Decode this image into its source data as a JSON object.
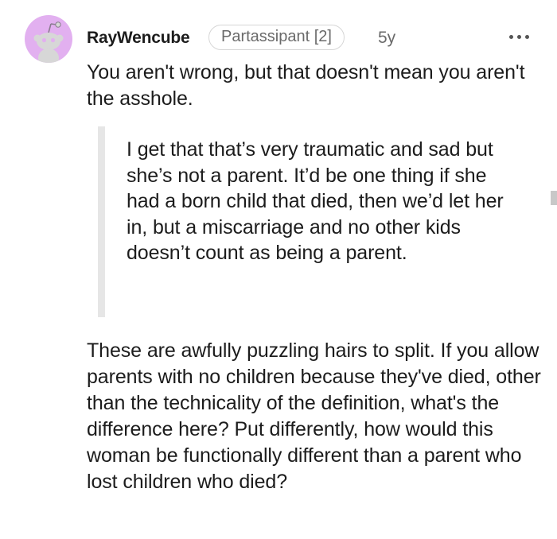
{
  "comment": {
    "author": "RayWencube",
    "flair": "Partassipant [2]",
    "age": "5y",
    "more_label": "•••",
    "paragraph_1": "You aren't wrong, but that doesn't mean you aren't the asshole.",
    "quote": "I get that that’s very traumatic and sad but she’s not a parent. It’d be one thing if she had a born child that died, then we’d let her in, but a miscarriage and no other kids doesn’t count as being a parent.",
    "paragraph_2": "These are awfully puzzling hairs to split. If you allow parents with no children because they've died, other than the technicality of the definition, what's the difference here? Put differently, how would this woman be functionally different than a parent who lost children who died?"
  },
  "icons": {
    "avatar": "reddit-snoo-avatar-icon",
    "more": "more-options-icon"
  },
  "colors": {
    "avatar_bg": "#e2b0f0",
    "snoo": "#d7d7d7",
    "text": "#1c1c1c",
    "muted": "#6a6a6a",
    "quote_bar": "#e6e6e6"
  }
}
